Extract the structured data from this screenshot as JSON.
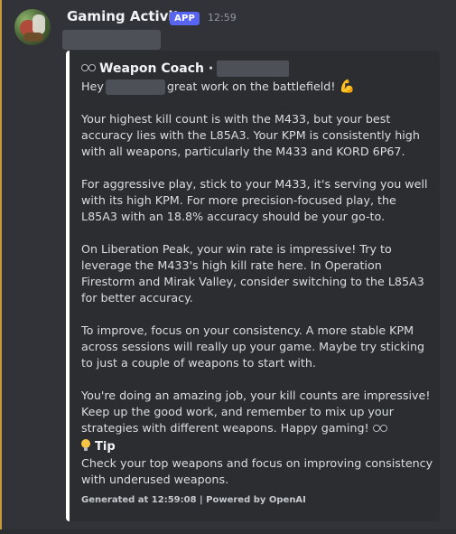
{
  "message": {
    "username": "Gaming Activity",
    "badge": "APP",
    "timestamp": "12:59"
  },
  "embed": {
    "title": "Weapon Coach ·",
    "greeting_prefix": "Hey",
    "greeting_suffix": "great work on the battlefield!",
    "paragraphs": [
      "Your highest kill count is with the M433, but your best accuracy lies with the L85A3. Your KPM is consistently high with all weapons, particularly the M433 and KORD 6P67.",
      "For aggressive play, stick to your M433, it's serving you well with its high KPM. For more precision-focused play, the L85A3 with an 18.8% accuracy should be your go-to.",
      "On Liberation Peak, your win rate is impressive! Try to leverage the M433's high kill rate here. In Operation Firestorm and Mirak Valley, consider switching to the L85A3 for better accuracy.",
      "To improve, focus on your consistency. A more stable KPM across sessions will really up your game. Maybe try sticking to just a couple of weapons to start with.",
      "You're doing an amazing job, your kill counts are impressive! Keep up the good work, and remember to mix up your strategies with different weapons. Happy gaming!"
    ],
    "tip_title": "Tip",
    "tip_text": "Check your top weapons and focus on improving consistency with underused weapons.",
    "footer": "Generated at 12:59:08 | Powered by OpenAI"
  },
  "icons": {
    "title": "sunglasses-icon",
    "greeting": "flexed-biceps-icon",
    "closing": "sunglasses-icon",
    "tip": "light-bulb-icon"
  }
}
